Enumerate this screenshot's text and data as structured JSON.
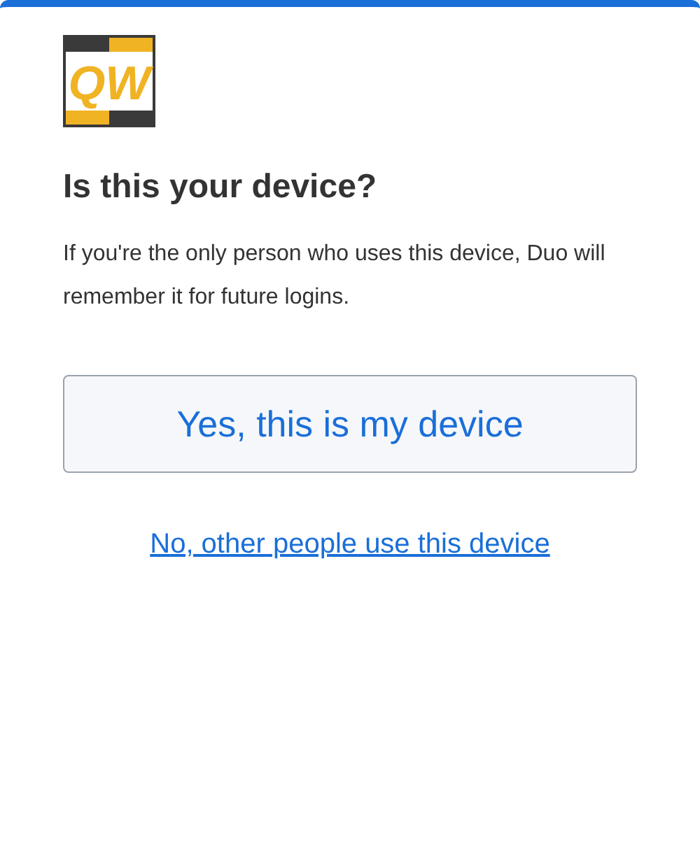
{
  "logo": {
    "text": "QW"
  },
  "heading": "Is this your device?",
  "description": "If you're the only person who uses this device, Duo will remember it for future logins.",
  "primary_button": "Yes, this is my device",
  "secondary_link": "No, other people use this device"
}
